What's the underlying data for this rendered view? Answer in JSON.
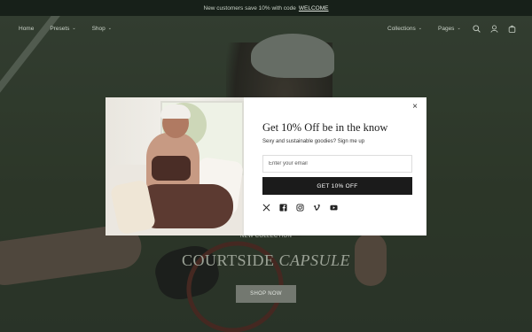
{
  "announcement": {
    "text": "New customers save 10% with code",
    "code": "WELCOME"
  },
  "nav": {
    "left": [
      {
        "label": "Home",
        "has_dropdown": false
      },
      {
        "label": "Presets",
        "has_dropdown": true
      },
      {
        "label": "Shop",
        "has_dropdown": true
      }
    ],
    "right": [
      {
        "label": "Collections",
        "has_dropdown": true
      },
      {
        "label": "Pages",
        "has_dropdown": true
      }
    ],
    "icons": [
      "search-icon",
      "account-icon",
      "cart-icon"
    ]
  },
  "hero": {
    "subtitle": "NEW COLLECTION",
    "title_regular": "COURTSIDE",
    "title_italic": "CAPSULE",
    "button_label": "SHOP NOW"
  },
  "popup": {
    "title": "Get 10% Off be in the know",
    "subtitle": "Sexy and sustainable goodies? Sign me up",
    "email_placeholder": "Enter your email",
    "submit_label": "GET 10% OFF",
    "close_symbol": "×",
    "socials": [
      "x-icon",
      "facebook-icon",
      "instagram-icon",
      "vimeo-icon",
      "youtube-icon"
    ]
  },
  "colors": {
    "announcement_bg": "#172019",
    "hero_overlay": "#3b4538",
    "button_dark": "#1b1b1b"
  }
}
